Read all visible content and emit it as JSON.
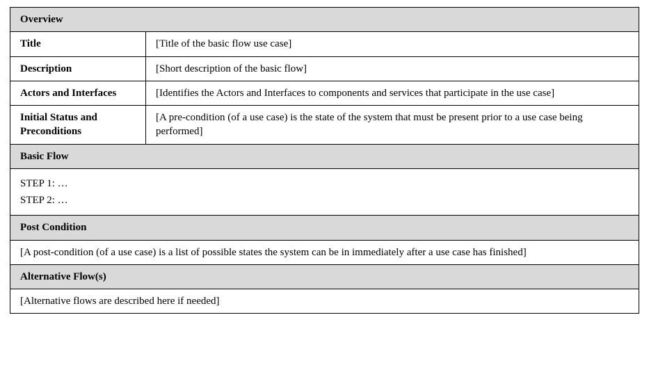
{
  "overview": {
    "header": "Overview",
    "rows": {
      "title_label": "Title",
      "title_value": "[Title of the basic flow use case]",
      "description_label": "Description",
      "description_value": "[Short description of the basic flow]",
      "actors_label": "Actors and Interfaces",
      "actors_value": "[Identifies the Actors and Interfaces to components and services that participate in the use case]",
      "initial_label": "Initial Status and Preconditions",
      "initial_value": "[A pre-condition (of a use case) is the state of the system that must be present prior to a use case being performed]"
    }
  },
  "basic_flow": {
    "header": "Basic Flow",
    "steps": [
      "STEP 1: …",
      "STEP 2: …"
    ]
  },
  "post_condition": {
    "header": "Post Condition",
    "value": "[A post-condition (of a use case) is a list of possible states the system can be in immediately after a use case has finished]"
  },
  "alternative_flow": {
    "header": "Alternative Flow(s)",
    "value": "[Alternative flows are described here if needed]"
  }
}
